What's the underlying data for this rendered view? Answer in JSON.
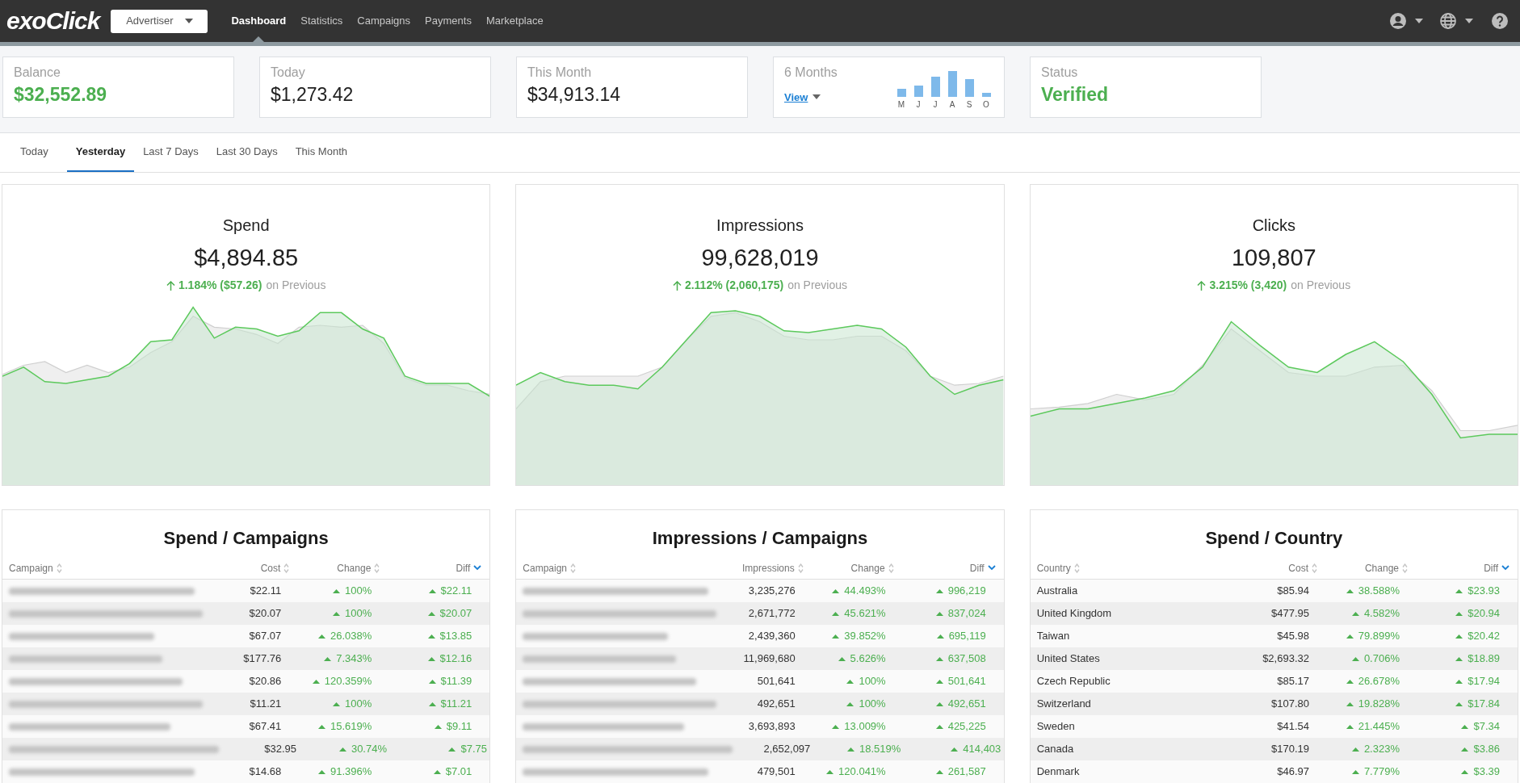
{
  "header": {
    "logo": "exoClick",
    "account_menu": "Advertiser",
    "nav": [
      {
        "label": "Dashboard",
        "selected": true
      },
      {
        "label": "Statistics",
        "selected": false
      },
      {
        "label": "Campaigns",
        "selected": false
      },
      {
        "label": "Payments",
        "selected": false
      },
      {
        "label": "Marketplace",
        "selected": false
      }
    ]
  },
  "summary": [
    {
      "kind": "value",
      "label": "Balance",
      "value": "$32,552.89",
      "highlight": true
    },
    {
      "kind": "value",
      "label": "Today",
      "value": "$1,273.42",
      "highlight": false
    },
    {
      "kind": "value",
      "label": "This Month",
      "value": "$34,913.14",
      "highlight": false
    },
    {
      "kind": "chart",
      "label": "6 Months",
      "link": "View",
      "months": [
        "M",
        "J",
        "J",
        "A",
        "S",
        "O"
      ]
    },
    {
      "kind": "value",
      "label": "Status",
      "value": "Verified",
      "highlight": true
    }
  ],
  "period_tabs": [
    {
      "label": "Today",
      "selected": false
    },
    {
      "label": "Yesterday",
      "selected": true
    },
    {
      "label": "Last 7 Days",
      "selected": false
    },
    {
      "label": "Last 30 Days",
      "selected": false
    },
    {
      "label": "This Month",
      "selected": false
    }
  ],
  "metrics": [
    {
      "title": "Spend",
      "value": "$4,894.85",
      "change": "1.184% ($57.26)",
      "comparison": "on Previous"
    },
    {
      "title": "Impressions",
      "value": "99,628,019",
      "change": "2.112% (2,060,175)",
      "comparison": "on Previous"
    },
    {
      "title": "Clicks",
      "value": "109,807",
      "change": "3.215% (3,420)",
      "comparison": "on Previous"
    }
  ],
  "tables": [
    {
      "title": "Spend / Campaigns",
      "columns": [
        {
          "label": "Campaign",
          "sorted": false
        },
        {
          "label": "Cost",
          "sorted": false
        },
        {
          "label": "Change",
          "sorted": false
        },
        {
          "label": "Diff",
          "sorted": true
        }
      ],
      "rows": [
        {
          "cells": [
            "",
            "$22.11",
            "100%",
            "$22.11"
          ]
        },
        {
          "cells": [
            "",
            "$20.07",
            "100%",
            "$20.07"
          ]
        },
        {
          "cells": [
            "",
            "$67.07",
            "26.038%",
            "$13.85"
          ]
        },
        {
          "cells": [
            "",
            "$177.76",
            "7.343%",
            "$12.16"
          ]
        },
        {
          "cells": [
            "",
            "$20.86",
            "120.359%",
            "$11.39"
          ]
        },
        {
          "cells": [
            "",
            "$11.21",
            "100%",
            "$11.21"
          ]
        },
        {
          "cells": [
            "",
            "$67.41",
            "15.619%",
            "$9.11"
          ]
        },
        {
          "cells": [
            "",
            "$32.95",
            "30.74%",
            "$7.75"
          ]
        },
        {
          "cells": [
            "",
            "$14.68",
            "91.396%",
            "$7.01"
          ]
        }
      ]
    },
    {
      "title": "Impressions / Campaigns",
      "columns": [
        {
          "label": "Campaign",
          "sorted": false
        },
        {
          "label": "Impressions",
          "sorted": false
        },
        {
          "label": "Change",
          "sorted": false
        },
        {
          "label": "Diff",
          "sorted": true
        }
      ],
      "rows": [
        {
          "cells": [
            "",
            "3,235,276",
            "44.493%",
            "996,219"
          ]
        },
        {
          "cells": [
            "",
            "2,671,772",
            "45.621%",
            "837,024"
          ]
        },
        {
          "cells": [
            "",
            "2,439,360",
            "39.852%",
            "695,119"
          ]
        },
        {
          "cells": [
            "",
            "11,969,680",
            "5.626%",
            "637,508"
          ]
        },
        {
          "cells": [
            "",
            "501,641",
            "100%",
            "501,641"
          ]
        },
        {
          "cells": [
            "",
            "492,651",
            "100%",
            "492,651"
          ]
        },
        {
          "cells": [
            "",
            "3,693,893",
            "13.009%",
            "425,225"
          ]
        },
        {
          "cells": [
            "",
            "2,652,097",
            "18.519%",
            "414,403"
          ]
        },
        {
          "cells": [
            "",
            "479,501",
            "120.041%",
            "261,587"
          ]
        }
      ]
    },
    {
      "title": "Spend / Country",
      "columns": [
        {
          "label": "Country",
          "sorted": false
        },
        {
          "label": "Cost",
          "sorted": false
        },
        {
          "label": "Change",
          "sorted": false
        },
        {
          "label": "Diff",
          "sorted": true
        }
      ],
      "rows": [
        {
          "cells": [
            "Australia",
            "$85.94",
            "38.588%",
            "$23.93"
          ]
        },
        {
          "cells": [
            "United Kingdom",
            "$477.95",
            "4.582%",
            "$20.94"
          ]
        },
        {
          "cells": [
            "Taiwan",
            "$45.98",
            "79.899%",
            "$20.42"
          ]
        },
        {
          "cells": [
            "United States",
            "$2,693.32",
            "0.706%",
            "$18.89"
          ]
        },
        {
          "cells": [
            "Czech Republic",
            "$85.17",
            "26.678%",
            "$17.94"
          ]
        },
        {
          "cells": [
            "Switzerland",
            "$107.80",
            "19.828%",
            "$17.84"
          ]
        },
        {
          "cells": [
            "Sweden",
            "$41.54",
            "21.445%",
            "$7.34"
          ]
        },
        {
          "cells": [
            "Canada",
            "$170.19",
            "2.323%",
            "$3.86"
          ]
        },
        {
          "cells": [
            "Denmark",
            "$46.97",
            "7.779%",
            "$3.39"
          ]
        }
      ]
    }
  ]
}
